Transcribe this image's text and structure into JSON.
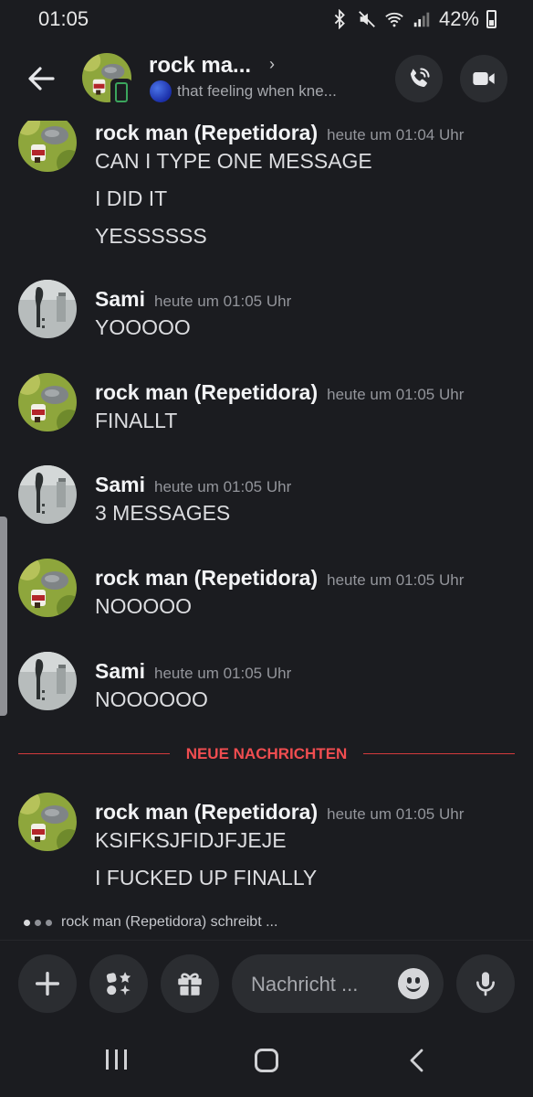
{
  "status_bar": {
    "time": "01:05",
    "battery": "42%"
  },
  "header": {
    "title": "rock ma...",
    "chevron": "›",
    "status_text": "that feeling when kne...",
    "icons": [
      "back-arrow-icon",
      "phone-icon",
      "video-icon"
    ]
  },
  "messages": [
    {
      "author": "rock man (Repetidora)",
      "timestamp": "heute um 01:04 Uhr",
      "lines": [
        "CAN I TYPE ONE MESSAGE",
        "I DID IT",
        "YESSSSSS"
      ]
    },
    {
      "author": "Sami",
      "timestamp": "heute um 01:05 Uhr",
      "lines": [
        "YOOOOO"
      ]
    },
    {
      "author": "rock man (Repetidora)",
      "timestamp": "heute um 01:05 Uhr",
      "lines": [
        "FINALLT"
      ]
    },
    {
      "author": "Sami",
      "timestamp": "heute um 01:05 Uhr",
      "lines": [
        "3 MESSAGES"
      ]
    },
    {
      "author": "rock man (Repetidora)",
      "timestamp": "heute um 01:05 Uhr",
      "lines": [
        "NOOOOO"
      ]
    },
    {
      "author": "Sami",
      "timestamp": "heute um 01:05 Uhr",
      "lines": [
        "NOOOOOO"
      ]
    },
    {
      "author": "rock man (Repetidora)",
      "timestamp": "heute um 01:05 Uhr",
      "lines": [
        "KSIFKSJFIDJFJEJE",
        "I FUCKED UP FINALLY"
      ]
    }
  ],
  "divider": {
    "label": "NEUE NACHRICHTEN",
    "color": "#f04d50"
  },
  "typing": {
    "text": "rock man (Repetidora) schreibt ..."
  },
  "composer": {
    "placeholder": "Nachricht ...",
    "icons": [
      "plus-icon",
      "apps-icon",
      "gift-icon",
      "emoji-icon",
      "microphone-icon"
    ]
  },
  "colors": {
    "background": "#1b1c20",
    "surface": "#2b2d31",
    "online": "#3ba55d",
    "accent_red": "#d33a3d"
  }
}
